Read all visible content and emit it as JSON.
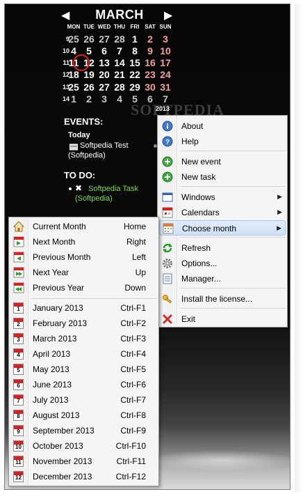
{
  "calendar": {
    "month": "MARCH",
    "year": "2013",
    "weekdays": [
      "MON",
      "TUE",
      "WED",
      "THU",
      "FRI",
      "SAT",
      "SUN"
    ],
    "weeks": [
      {
        "num": "9",
        "days": [
          "25",
          "26",
          "27",
          "28",
          "1",
          "2",
          "3"
        ]
      },
      {
        "num": "10",
        "days": [
          "4",
          "5",
          "6",
          "7",
          "8",
          "9",
          "10"
        ]
      },
      {
        "num": "11",
        "days": [
          "11",
          "12",
          "13",
          "14",
          "15",
          "16",
          "17"
        ]
      },
      {
        "num": "12",
        "days": [
          "18",
          "19",
          "20",
          "21",
          "22",
          "23",
          "24"
        ]
      },
      {
        "num": "13",
        "days": [
          "25",
          "26",
          "27",
          "28",
          "29",
          "30",
          "31"
        ]
      },
      {
        "num": "14",
        "days": [
          "1",
          "2",
          "3",
          "4",
          "5",
          "6",
          "7"
        ]
      }
    ],
    "today": "11",
    "watermark": "SOFTPEDIA"
  },
  "events": {
    "title": "EVENTS:",
    "day_label": "Today",
    "items": [
      "Softpedia Test",
      "(Softpedia)"
    ]
  },
  "todo": {
    "title": "TO DO:",
    "items": [
      "Softpedia Task",
      "(Softpedia)"
    ]
  },
  "context_menu": {
    "items": [
      {
        "label": "About",
        "icon": "info-icon",
        "has_sub": false
      },
      {
        "label": "Help",
        "icon": "help-icon",
        "has_sub": false
      },
      {
        "label": "New event",
        "icon": "add-icon",
        "has_sub": false
      },
      {
        "label": "New task",
        "icon": "add-icon",
        "has_sub": false
      },
      {
        "label": "Windows",
        "icon": "window-icon",
        "has_sub": true
      },
      {
        "label": "Calendars",
        "icon": "calendar-icon",
        "has_sub": true
      },
      {
        "label": "Choose month",
        "icon": "calendar-grid-icon",
        "has_sub": true,
        "highlighted": true
      },
      {
        "label": "Refresh",
        "icon": "refresh-icon",
        "has_sub": false
      },
      {
        "label": "Options...",
        "icon": "gear-icon",
        "has_sub": false
      },
      {
        "label": "Manager...",
        "icon": "list-icon",
        "has_sub": false
      },
      {
        "label": "Install the license...",
        "icon": "key-icon",
        "has_sub": false
      },
      {
        "label": "Exit",
        "icon": "close-icon",
        "has_sub": false
      }
    ]
  },
  "month_menu": {
    "nav_items": [
      {
        "label": "Current Month",
        "shortcut": "Home",
        "icon": "home-icon"
      },
      {
        "label": "Next Month",
        "shortcut": "Right",
        "icon": "next-month-icon"
      },
      {
        "label": "Previous Month",
        "shortcut": "Left",
        "icon": "previous-month-icon"
      },
      {
        "label": "Next Year",
        "shortcut": "Up",
        "icon": "next-year-icon"
      },
      {
        "label": "Previous Year",
        "shortcut": "Down",
        "icon": "previous-year-icon"
      }
    ],
    "months": [
      {
        "label": "January 2013",
        "shortcut": "Ctrl-F1",
        "num": "1"
      },
      {
        "label": "February 2013",
        "shortcut": "Ctrl-F2",
        "num": "2"
      },
      {
        "label": "March 2013",
        "shortcut": "Ctrl-F3",
        "num": "3"
      },
      {
        "label": "April 2013",
        "shortcut": "Ctrl-F4",
        "num": "4"
      },
      {
        "label": "May 2013",
        "shortcut": "Ctrl-F5",
        "num": "5"
      },
      {
        "label": "June 2013",
        "shortcut": "Ctrl-F6",
        "num": "6"
      },
      {
        "label": "July 2013",
        "shortcut": "Ctrl-F7",
        "num": "7"
      },
      {
        "label": "August 2013",
        "shortcut": "Ctrl-F8",
        "num": "8"
      },
      {
        "label": "September 2013",
        "shortcut": "Ctrl-F9",
        "num": "9"
      },
      {
        "label": "October 2013",
        "shortcut": "Ctrl-F10",
        "num": "10"
      },
      {
        "label": "November 2013",
        "shortcut": "Ctrl-F11",
        "num": "11"
      },
      {
        "label": "December 2013",
        "shortcut": "Ctrl-F12",
        "num": "12"
      }
    ]
  },
  "colors": {
    "weekend": "#f2a0a0",
    "today_ring": "#e81e1e",
    "todo_text": "#7ed95a",
    "menu_highlight": "#cfe0f6"
  }
}
